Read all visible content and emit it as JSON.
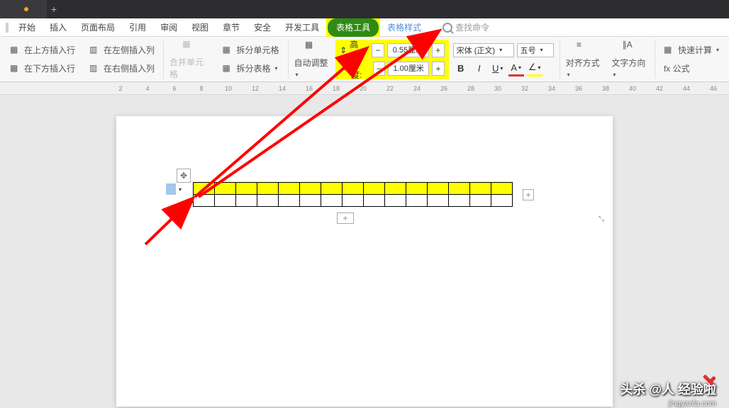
{
  "menu": {
    "start": "开始",
    "insert": "插入",
    "page_layout": "页面布局",
    "reference": "引用",
    "review": "审阅",
    "view": "视图",
    "chapter": "章节",
    "security": "安全",
    "dev_tools": "开发工具",
    "table_tools": "表格工具",
    "table_style": "表格样式",
    "search_ph": "查找命令"
  },
  "ribbon": {
    "insert_row_above": "在上方插入行",
    "insert_row_below": "在下方插入行",
    "insert_col_left": "在左侧插入列",
    "insert_col_right": "在右侧插入列",
    "merge_cells": "合并单元格",
    "split_cells": "拆分单元格",
    "split_table": "拆分表格",
    "auto_fit": "自动调整",
    "height_lbl": "高度:",
    "width_lbl": "宽度:",
    "height_val": "0.55厘米",
    "width_val": "1.00厘米",
    "font_family": "宋体 (正文)",
    "font_size": "五号",
    "align": "对齐方式",
    "text_dir": "文字方向",
    "quick_calc": "快速计算",
    "formula": "fx 公式"
  },
  "ruler": [
    "2",
    "4",
    "6",
    "8",
    "10",
    "12",
    "14",
    "16",
    "18",
    "20",
    "22",
    "24",
    "26",
    "28",
    "30",
    "32",
    "34",
    "36",
    "38",
    "40",
    "42",
    "44",
    "46"
  ],
  "watermark": {
    "line1": "头杀 @人 经验啦",
    "line2": "jingyanla.com"
  }
}
